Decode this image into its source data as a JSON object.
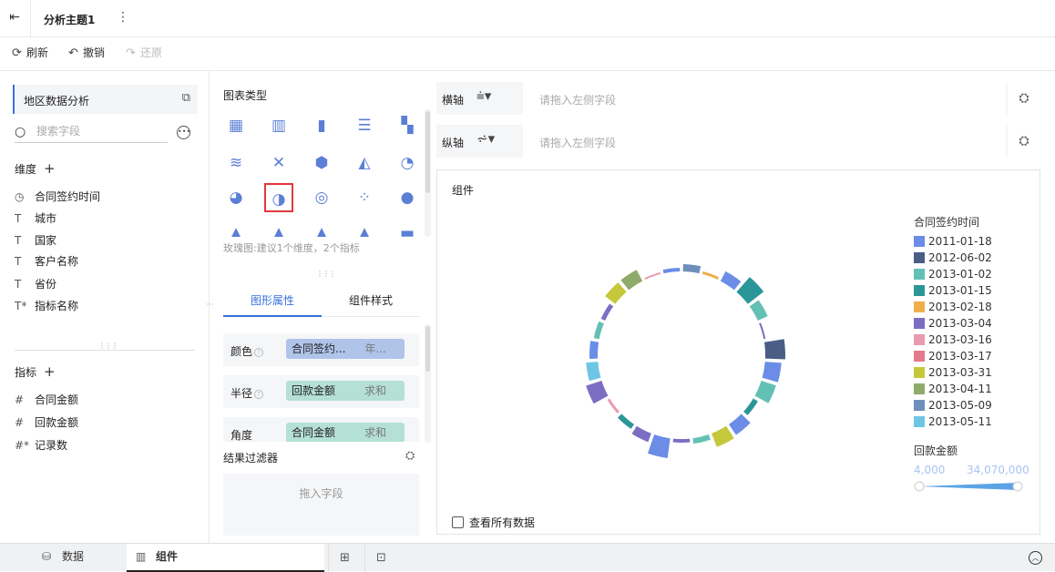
{
  "topbar": {
    "title": "分析主题1",
    "exit_icon": "exit-icon",
    "more_icon": "⋮"
  },
  "toolbar": {
    "refresh": "刷新",
    "undo": "撤销",
    "redo": "还原"
  },
  "left": {
    "dataset": "地区数据分析",
    "search_placeholder": "搜索字段",
    "dimensions_title": "维度",
    "dimensions": [
      {
        "icon": "clock",
        "name": "合同签约时间"
      },
      {
        "icon": "T",
        "name": "城市"
      },
      {
        "icon": "T",
        "name": "国家"
      },
      {
        "icon": "T",
        "name": "客户名称"
      },
      {
        "icon": "T",
        "name": "省份"
      },
      {
        "icon": "T*",
        "name": "指标名称"
      }
    ],
    "measures_title": "指标",
    "measures": [
      {
        "icon": "#",
        "name": "合同金额"
      },
      {
        "icon": "#",
        "name": "回款金额"
      },
      {
        "icon": "#*",
        "name": "记录数"
      }
    ]
  },
  "middle": {
    "chart_type_title": "图表类型",
    "chart_hint": "玫瑰图:建议1个维度，2个指标",
    "selected_chart": "rose-chart",
    "tabs": [
      "图形属性",
      "组件样式"
    ],
    "active_tab": 0,
    "properties": [
      {
        "label": "颜色",
        "field": "合同签约...",
        "agg": "年...",
        "color": "#b0c4ea"
      },
      {
        "label": "半径",
        "field": "回款金额",
        "agg": "求和",
        "color": "#b4e0d6"
      },
      {
        "label": "角度",
        "field": "合同金额",
        "agg": "求和",
        "color": "#b4e0d6"
      }
    ],
    "filter_title": "结果过滤器",
    "filter_drop": "拖入字段"
  },
  "axes": {
    "x_label": "横轴",
    "y_label": "纵轴",
    "placeholder": "请拖入左侧字段"
  },
  "canvas": {
    "title": "组件",
    "legend_title": "合同签约时间",
    "legend": [
      {
        "label": "2011-01-18",
        "color": "#6b8de8"
      },
      {
        "label": "2012-06-02",
        "color": "#4a5e85"
      },
      {
        "label": "2013-01-02",
        "color": "#63c0b4"
      },
      {
        "label": "2013-01-15",
        "color": "#2a9699"
      },
      {
        "label": "2013-02-18",
        "color": "#f0ae4a"
      },
      {
        "label": "2013-03-04",
        "color": "#7b6fc4"
      },
      {
        "label": "2013-03-16",
        "color": "#e89ab0"
      },
      {
        "label": "2013-03-17",
        "color": "#e47a8c"
      },
      {
        "label": "2013-03-31",
        "color": "#c4c83a"
      },
      {
        "label": "2013-04-11",
        "color": "#8fab6b"
      },
      {
        "label": "2013-05-09",
        "color": "#6e8fba"
      },
      {
        "label": "2013-05-11",
        "color": "#6ec6e4"
      }
    ],
    "size_title": "回款金额",
    "size_min": "4,000",
    "size_max": "34,070,000",
    "show_all": "查看所有数据"
  },
  "chart_data": {
    "type": "rose",
    "note_fields": {
      "color": "合同签约时间",
      "radius": "回款金额",
      "angle": "合同金额"
    }
  },
  "bottom": {
    "data_tab": "数据",
    "component_tab": "组件"
  }
}
